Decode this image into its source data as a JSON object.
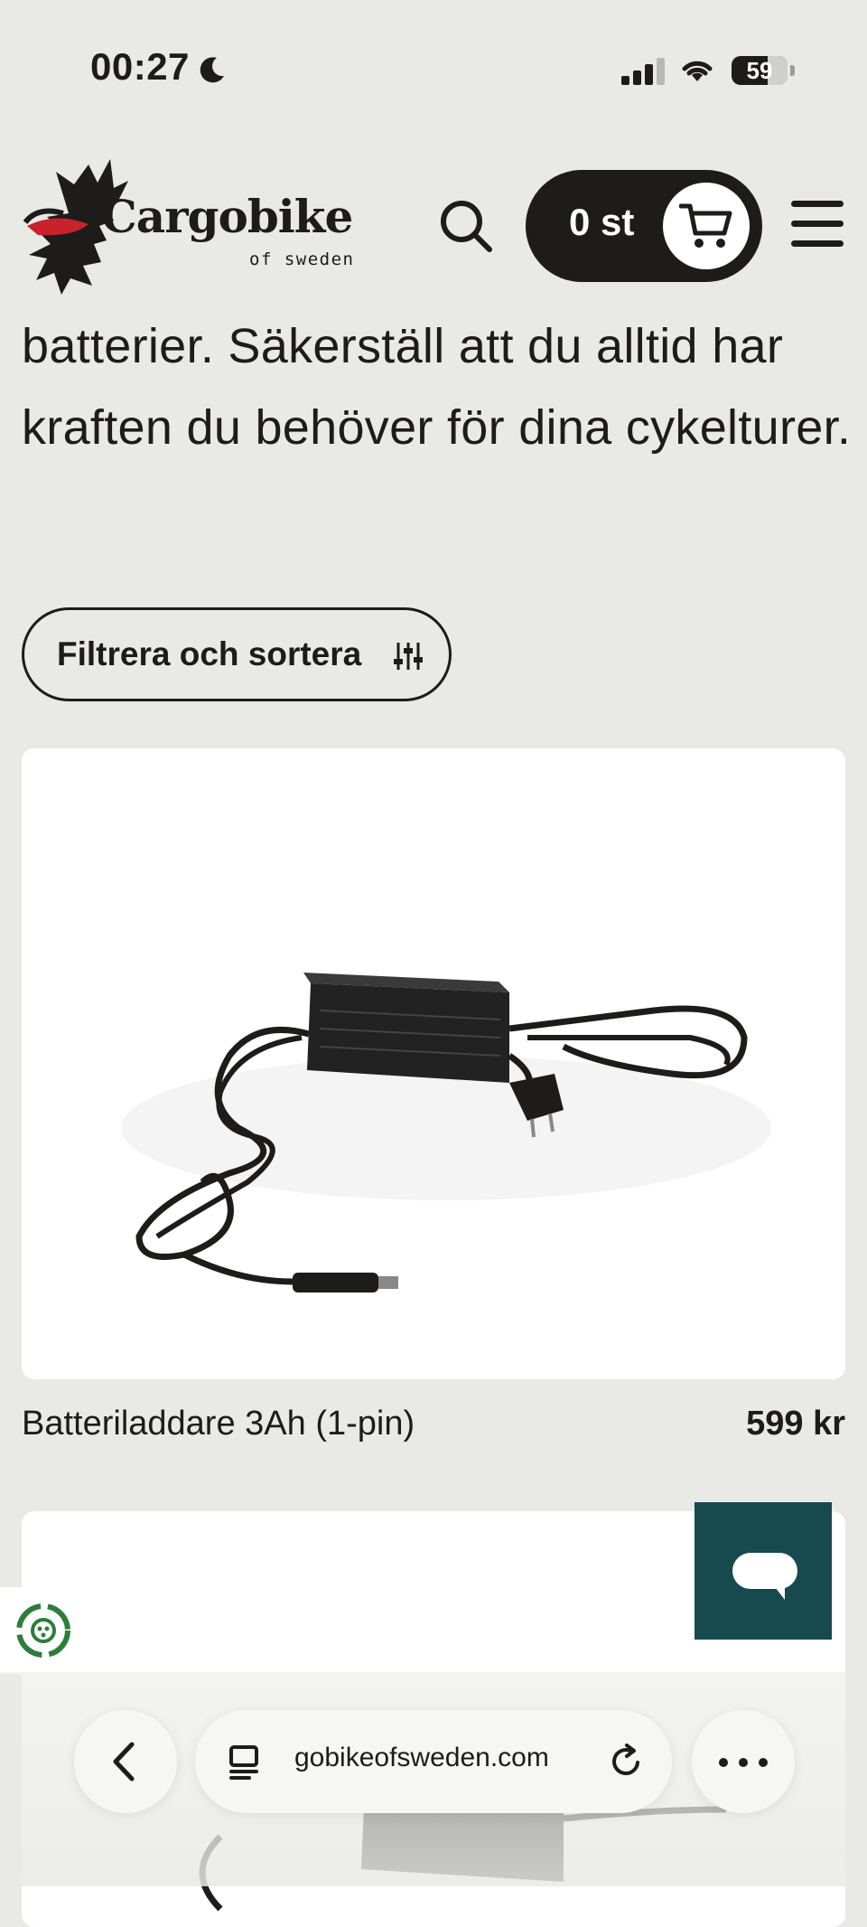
{
  "status_bar": {
    "time": "00:27",
    "battery_level": "59"
  },
  "header": {
    "logo_name": "Cargobike",
    "logo_sub": "of sweden",
    "cart_count": "0 st"
  },
  "intro": {
    "text": "batterier. Säkerställ att du alltid har kraften du behöver för dina cykelturer."
  },
  "filter": {
    "label": "Filtrera och sortera"
  },
  "products": [
    {
      "name": "Batteriladdare 3Ah (1-pin)",
      "price": "599 kr"
    }
  ],
  "browser": {
    "url": "gobikeofsweden.com"
  },
  "colors": {
    "background": "#e9e9e5",
    "text": "#1d1c1a",
    "chat_button": "#164a4f",
    "card": "#ffffff"
  }
}
